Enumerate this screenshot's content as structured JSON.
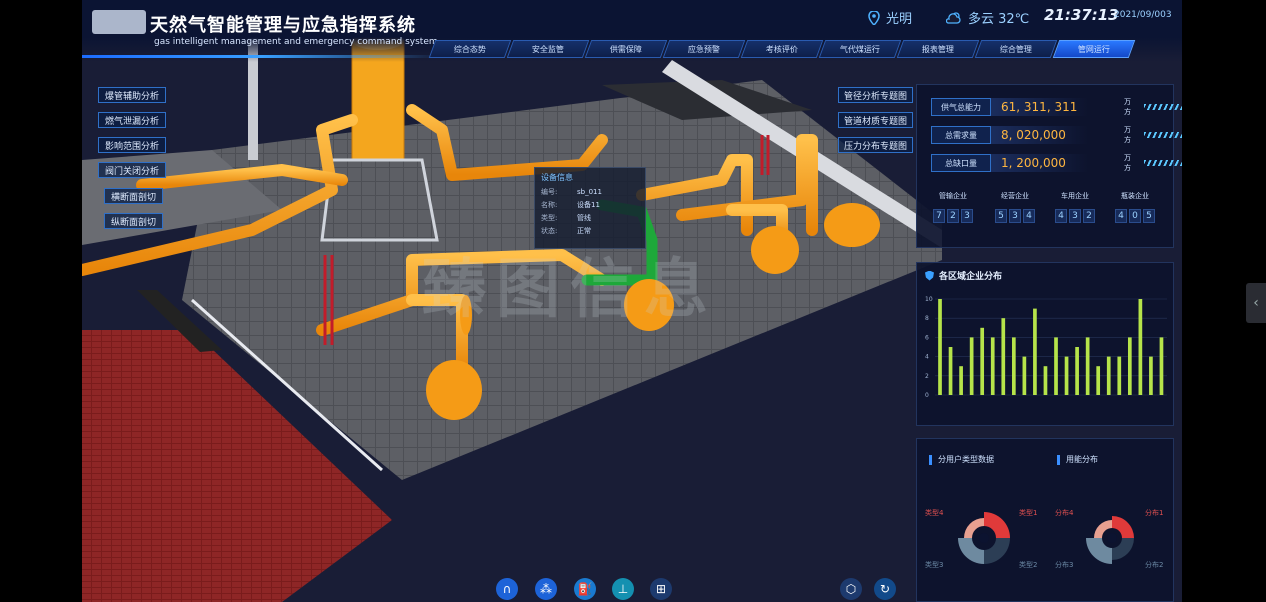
{
  "header": {
    "title_cn": "天然气智能管理与应急指挥系统",
    "title_en": "gas intelligent management and emergency command system",
    "location": "光明",
    "weather": "多云 32℃",
    "time": "21:37:13",
    "date": "2021/09/003"
  },
  "nav": {
    "tabs": [
      "综合态势",
      "安全监管",
      "供需保障",
      "应急预警",
      "考核评价",
      "气代煤运行",
      "报表管理",
      "综合管理",
      "管网运行"
    ],
    "active_index": 8
  },
  "scene": {
    "watermark": "臻图信息"
  },
  "left_menu": {
    "items": [
      "爆管辅助分析",
      "燃气泄漏分析",
      "影响范围分析",
      "阀门关闭分析",
      "横断面剖切",
      "纵断面剖切"
    ]
  },
  "popup": {
    "title": "设备信息",
    "rows": [
      {
        "k": "编号:",
        "v": "sb_011"
      },
      {
        "k": "名称:",
        "v": "设备11"
      },
      {
        "k": "类型:",
        "v": "管线"
      },
      {
        "k": "状态:",
        "v": "正常"
      }
    ]
  },
  "right_topics": {
    "items": [
      "管径分析专题图",
      "管道材质专题图",
      "压力分布专题图"
    ]
  },
  "supply_panel": {
    "stats": [
      {
        "label": "供气总能力",
        "value": "61, 311, 311",
        "unit": "万方"
      },
      {
        "label": "总需求量",
        "value": "8, 020,000",
        "unit": "万方"
      },
      {
        "label": "总缺口量",
        "value": "1, 200,000",
        "unit": "万方"
      }
    ],
    "enterprises": [
      {
        "label": "管输企业",
        "digits": [
          "7",
          "2",
          "3"
        ]
      },
      {
        "label": "经营企业",
        "digits": [
          "5",
          "3",
          "4"
        ]
      },
      {
        "label": "车用企业",
        "digits": [
          "4",
          "3",
          "2"
        ]
      },
      {
        "label": "瓶装企业",
        "digits": [
          "4",
          "0",
          "5"
        ]
      }
    ]
  },
  "region_chart": {
    "title": "各区域企业分布",
    "chart_data": {
      "type": "bar",
      "title": "各区域企业分布",
      "ylim": [
        0,
        10
      ],
      "yticks": [
        0,
        2,
        4,
        6,
        8,
        10
      ],
      "values": [
        10,
        5,
        3,
        6,
        7,
        6,
        8,
        6,
        4,
        9,
        3,
        6,
        4,
        5,
        6,
        3,
        4,
        4,
        6,
        10,
        4,
        6
      ],
      "bar_color": "#b6e44a"
    }
  },
  "user_panel": {
    "left_title": "分用户类型数据",
    "right_title": "用能分布",
    "left_labels": [
      "类型4",
      "类型1",
      "类型3",
      "类型2"
    ],
    "right_labels": [
      "分布4",
      "分布1",
      "分布3",
      "分布2"
    ]
  },
  "toolbar": {
    "icons": [
      "pipe-network-icon",
      "topology-icon",
      "gas-station-icon",
      "valve-icon",
      "grid-icon",
      "model-icon",
      "refresh-icon"
    ]
  },
  "colors": {
    "accent": "#2f70c8",
    "value": "#ffb640",
    "pipe": "#ffa31a"
  }
}
